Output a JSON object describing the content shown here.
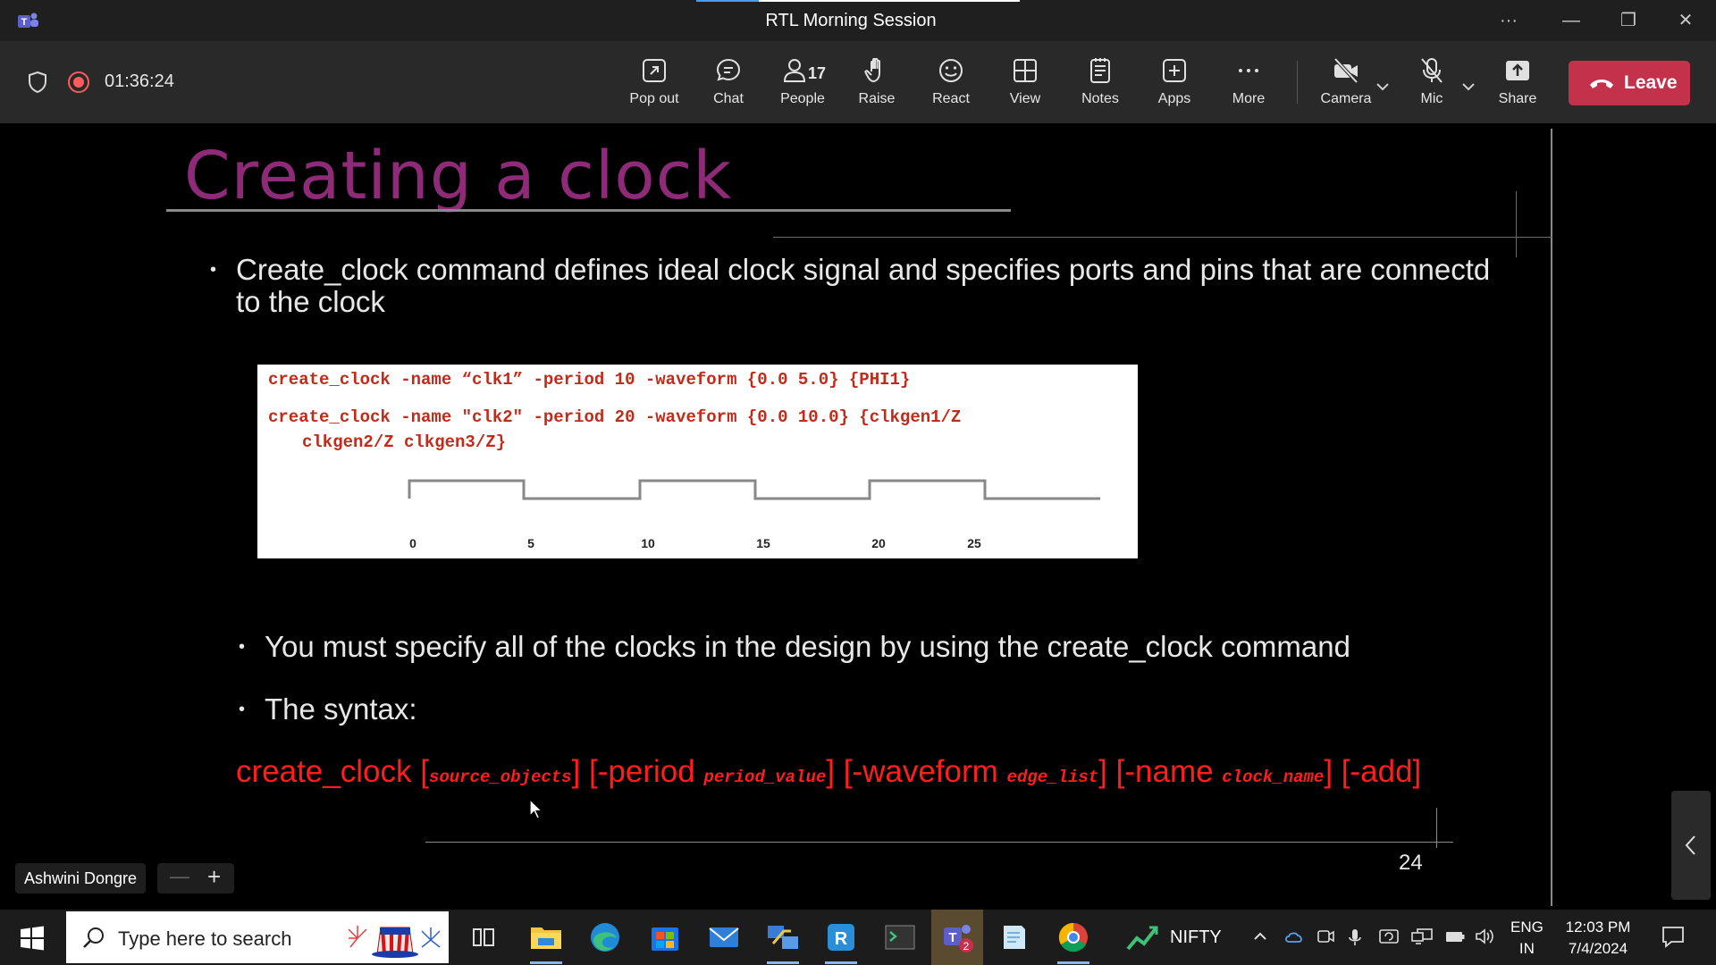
{
  "window": {
    "title": "RTL Morning Session",
    "controls": {
      "more": "···",
      "minimize": "—",
      "restore": "❐",
      "close": "✕"
    }
  },
  "meeting": {
    "elapsed": "01:36:24",
    "people_count": "17",
    "toolbar": {
      "pop_out": "Pop out",
      "chat": "Chat",
      "people": "People",
      "raise": "Raise",
      "react": "React",
      "view": "View",
      "notes": "Notes",
      "apps": "Apps",
      "more": "More",
      "camera": "Camera",
      "mic": "Mic",
      "share": "Share",
      "leave": "Leave"
    },
    "leave_color": "#c4314b",
    "presenter_name": "Ashwini Dongre"
  },
  "slide": {
    "title": "Creating a clock",
    "title_color": "#8e2a78",
    "bullet1": "Create_clock command defines ideal clock signal and specifies ports and pins that are connectd to the clock",
    "code": {
      "line1": "create_clock -name “clk1” -period 10 -waveform {0.0 5.0} {PHI1}",
      "line2": "create_clock -name \"clk2\" -period 20 -waveform  {0.0 10.0} {clkgen1/Z",
      "line3": "clkgen2/Z clkgen3/Z}",
      "ticks": [
        "0",
        "5",
        "10",
        "15",
        "20",
        "25"
      ],
      "code_color": "#c02b1a"
    },
    "bullet2": "You must specify all of the clocks in the design by using the create_clock command",
    "bullet3": "The syntax:",
    "syntax": {
      "cmd": "create_clock",
      "p1_open": " [",
      "p1_arg": "source_objects",
      "p1_close": "]",
      "p2_open": " [-period ",
      "p2_arg": "period_value",
      "p2_close": "]",
      "p3_open": " [-waveform ",
      "p3_arg": "edge_list",
      "p3_close": "]",
      "p4_open": " [-name ",
      "p4_arg": "clock_name",
      "p4_close": "]",
      "p5": " [-add]",
      "color": "#ff1d1d"
    },
    "page_number": "24"
  },
  "taskbar": {
    "search_placeholder": "Type here to search",
    "nifty_label": "NIFTY",
    "language": "ENG",
    "region": "IN",
    "time": "12:03 PM",
    "date": "7/4/2024",
    "teams_badge": "2"
  }
}
